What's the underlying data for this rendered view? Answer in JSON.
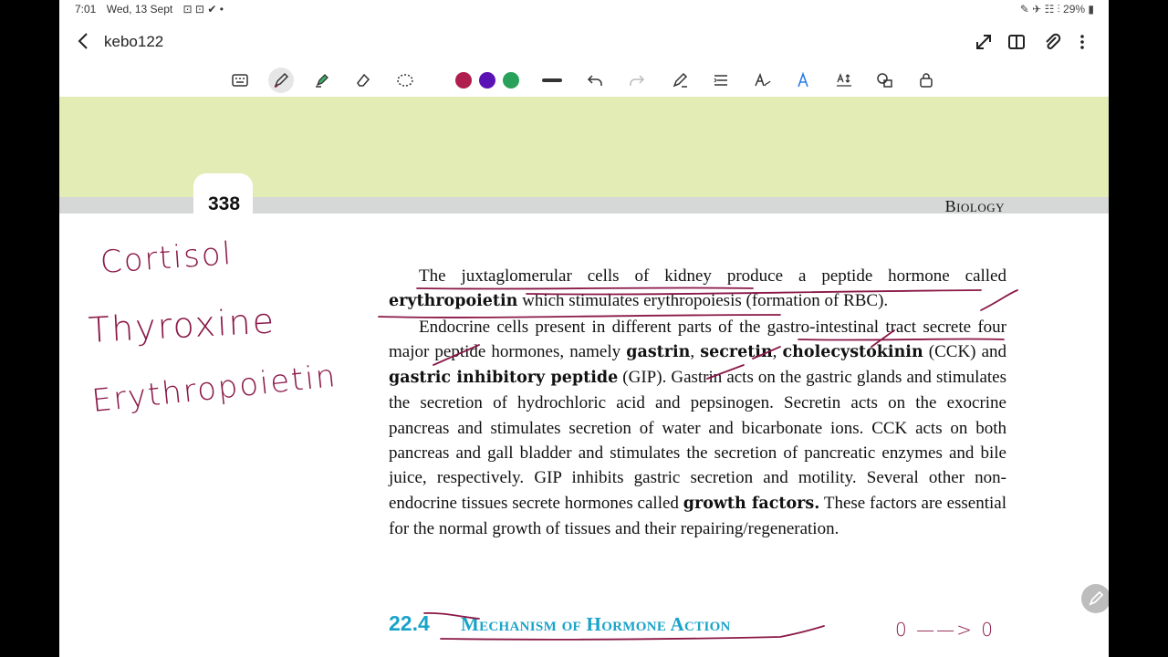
{
  "status_bar": {
    "time": "7:01",
    "date": "Wed, 13 Sept",
    "notif_icons": "⊡ ⊡ ✔ •",
    "right_icons": "✎ ✈ ☷ ⫶",
    "battery": "29%"
  },
  "header": {
    "title": "kebo122",
    "icons": [
      "back-icon",
      "expand-icon",
      "book-view-icon",
      "attach-icon",
      "more-icon"
    ]
  },
  "toolbar": {
    "tools": [
      "keyboard-icon",
      "pen-icon",
      "highlighter-icon",
      "eraser-icon",
      "lasso-icon",
      "stroke-width-icon",
      "undo-icon",
      "redo-icon",
      "pen-settings-icon",
      "text-align-icon",
      "handwriting-text-icon",
      "text-style-icon",
      "text-spacing-icon",
      "shapes-icon",
      "lock-icon"
    ],
    "colors": [
      "#b01e4e",
      "#5a12b4",
      "#28a25a"
    ]
  },
  "page": {
    "number": "338",
    "running_head": "Biology",
    "para1": {
      "text1": "The juxtaglomerular cells of kidney produce a peptide hormone called ",
      "bold1": "erythropoietin",
      "text2": " which stimulates erythropoiesis (formation of RBC)."
    },
    "para2": {
      "text1": "Endocrine cells present in different parts of the gastro-intestinal tract secrete four major peptide hormones, namely ",
      "bold1": "gastrin",
      "sep1": ", ",
      "bold2": "secretin",
      "sep2": ", ",
      "bold3": "cholecystokinin",
      "text2": " (CCK) and ",
      "bold4": "gastric inhibitory peptide",
      "text3": " (GIP). Gastrin acts on the gastric glands and stimulates the secretion of hydrochloric acid and pepsinogen. Secretin acts on the exocrine pancreas and stimulates secretion of water and bicarbonate ions. CCK acts on both pancreas and gall bladder and stimulates the secretion of pancreatic enzymes and bile juice, respectively. GIP inhibits gastric secretion and motility. Several other non-endocrine tissues secrete hormones called ",
      "bold5": "growth factors.",
      "text4": " These factors are essential for the normal growth of tissues and their repairing/regeneration."
    },
    "section_number": "22.4",
    "section_title": "Mechanism of Hormone Action"
  },
  "annotations": {
    "ink_color": "#8a1848",
    "words": [
      "Cortisol",
      "Thyroxine",
      "Erythropoietin"
    ],
    "arrow_note": "0 ——> 0"
  }
}
